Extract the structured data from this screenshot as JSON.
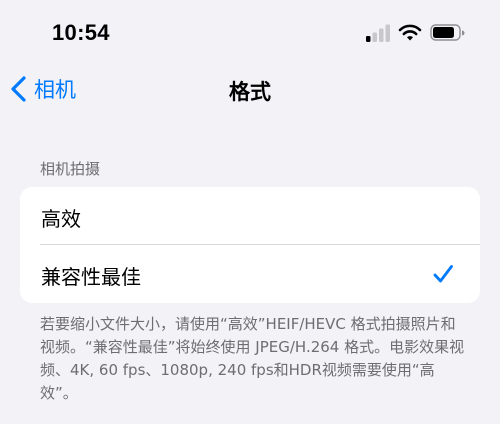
{
  "status_bar": {
    "time": "10:54",
    "icons": [
      "signal-icon",
      "wifi-icon",
      "battery-icon"
    ]
  },
  "nav": {
    "back_label": "相机",
    "title": "格式"
  },
  "section": {
    "header": "相机拍摄",
    "options": [
      {
        "label": "高效",
        "selected": false
      },
      {
        "label": "兼容性最佳",
        "selected": true
      }
    ],
    "footer": "若要缩小文件大小，请使用“高效”HEIF/HEVC 格式拍摄照片和视频。“兼容性最佳”将始终使用 JPEG/H.264 格式。电影效果视频、4K, 60 fps、1080p, 240 fps和HDR视频需要使用“高效”。"
  },
  "colors": {
    "accent": "#007aff",
    "background": "#f2f2f7",
    "secondary_text": "#6d6d72"
  }
}
